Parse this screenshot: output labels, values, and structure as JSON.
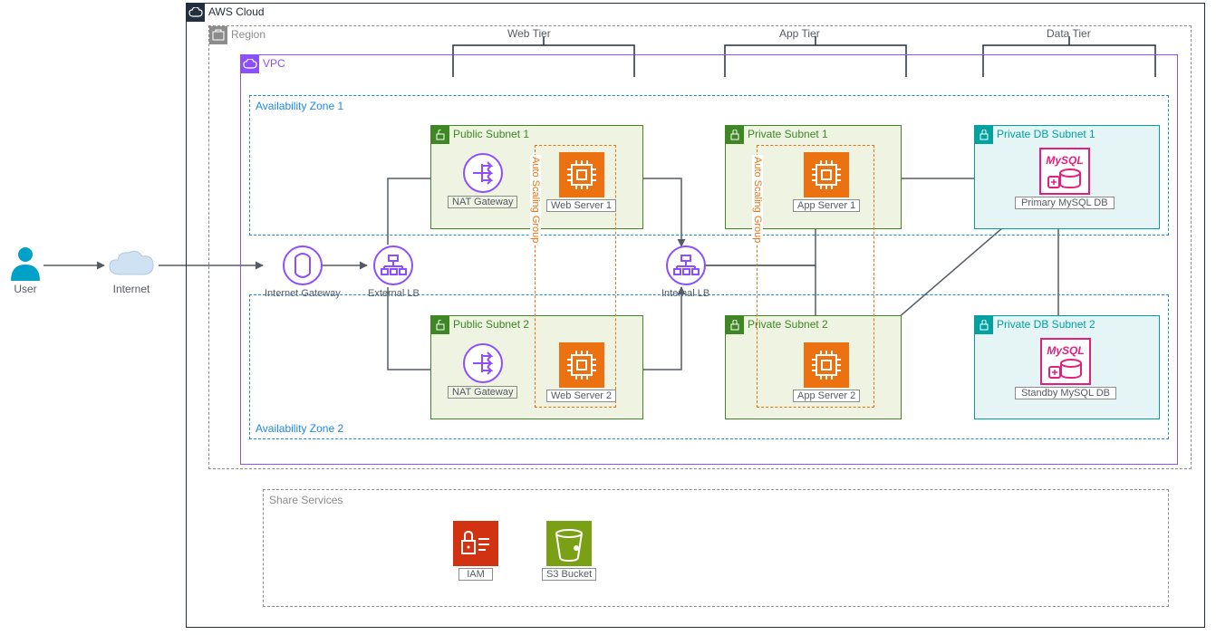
{
  "user_label": "User",
  "internet_label": "Internet",
  "cloud_label": "AWS Cloud",
  "region_label": "Region",
  "vpc_label": "VPC",
  "az1_label": "Availability Zone 1",
  "az2_label": "Availability Zone 2",
  "share_services_label": "Share Services",
  "tiers": {
    "web": "Web Tier",
    "app": "App Tier",
    "data": "Data Tier"
  },
  "subnets": {
    "public1": "Public Subnet 1",
    "public2": "Public Subnet 2",
    "private1": "Private Subnet 1",
    "private2": "Private Subnet 2",
    "db1": "Private DB Subnet 1",
    "db2": "Private DB Subnet 2"
  },
  "asg": {
    "web": "Auto Scaling Group",
    "app": "Auto Scaling Group"
  },
  "components": {
    "igw": "Internet Gateway",
    "ext_lb": "External LB",
    "int_lb": "Internal LB",
    "nat1": "NAT Gateway",
    "nat2": "NAT Gateway",
    "web1": "Web Server 1",
    "web2": "Web Server 2",
    "app1": "App Server 1",
    "app2": "App Server 2",
    "db1": "Primary MySQL DB",
    "db2": "Standby MySQL DB",
    "iam": "IAM",
    "s3": "S3 Bucket",
    "mysql_text": "MySQL"
  },
  "colors": {
    "black": "#232f3e",
    "grey": "#8c8c8c",
    "purple": "#8c4fff",
    "blue": "#1e88e5",
    "green_border": "#3f8624",
    "green_bg": "#eef3e2",
    "teal_border": "#00a1a1",
    "teal_bg": "#e5f5f5",
    "orange": "#ec7211",
    "olive": "#7aa116",
    "red": "#d13212",
    "magenta": "#e41f7b"
  }
}
